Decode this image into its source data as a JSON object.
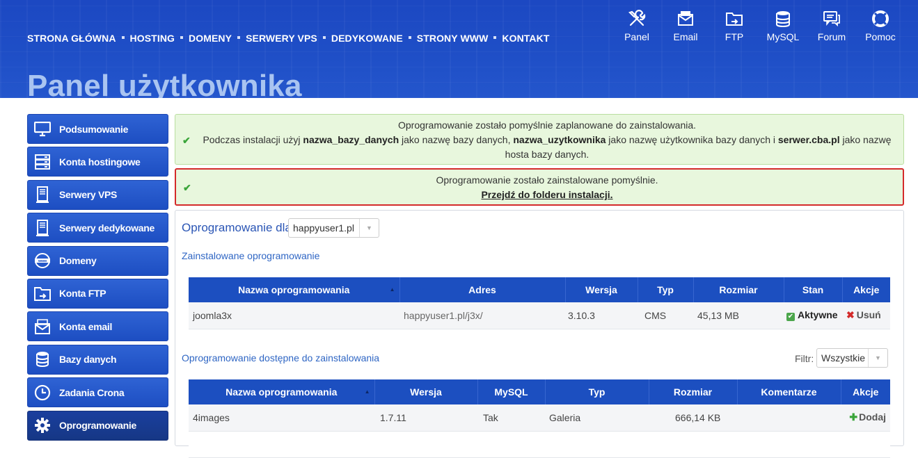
{
  "header": {
    "nav": [
      "STRONA GŁÓWNA",
      "HOSTING",
      "DOMENY",
      "SERWERY VPS",
      "DEDYKOWANE",
      "STRONY WWW",
      "KONTAKT"
    ],
    "quick_links": [
      {
        "label": "Panel",
        "icon": "tools-icon"
      },
      {
        "label": "Email",
        "icon": "email-icon"
      },
      {
        "label": "FTP",
        "icon": "ftp-folder-icon"
      },
      {
        "label": "MySQL",
        "icon": "database-icon"
      },
      {
        "label": "Forum",
        "icon": "forum-icon"
      },
      {
        "label": "Pomoc",
        "icon": "lifebuoy-icon"
      }
    ],
    "page_title": "Panel użytkownika"
  },
  "sidebar": {
    "items": [
      {
        "label": "Podsumowanie",
        "icon": "monitor-icon"
      },
      {
        "label": "Konta hostingowe",
        "icon": "server-stack-icon"
      },
      {
        "label": "Serwery VPS",
        "icon": "server-tower-icon"
      },
      {
        "label": "Serwery dedykowane",
        "icon": "server-tower-icon"
      },
      {
        "label": "Domeny",
        "icon": "www-globe-icon"
      },
      {
        "label": "Konta FTP",
        "icon": "ftp-folder-icon"
      },
      {
        "label": "Konta email",
        "icon": "email-icon"
      },
      {
        "label": "Bazy danych",
        "icon": "database-icon"
      },
      {
        "label": "Zadania Crona",
        "icon": "clock-icon"
      },
      {
        "label": "Oprogramowanie",
        "icon": "gear-icon"
      }
    ],
    "active": "Oprogramowanie"
  },
  "alerts": {
    "scheduled": {
      "line1": "Oprogramowanie zostało pomyślnie zaplanowane do zainstalowania.",
      "p1": "Podczas instalacji użyj ",
      "db_name": "nazwa_bazy_danych",
      "p2": " jako nazwę bazy danych, ",
      "db_user": "nazwa_uzytkownika",
      "p3": " jako nazwę użytkownika bazy danych i ",
      "db_host": "serwer.cba.pl",
      "p4": " jako nazwę hosta bazy danych."
    },
    "installed": {
      "line1": "Oprogramowanie zostało zainstalowane pomyślnie.",
      "link": "Przejdź do folderu instalacji."
    }
  },
  "software": {
    "for_label": "Oprogramowanie dla",
    "account": "happyuser1.pl",
    "installed_title": "Zainstalowane oprogramowanie",
    "installed_headers": [
      "Nazwa oprogramowania",
      "Adres",
      "Wersja",
      "Typ",
      "Rozmiar",
      "Stan",
      "Akcje"
    ],
    "installed_rows": [
      {
        "name": "joomla3x",
        "address": "happyuser1.pl/j3x/",
        "version": "3.10.3",
        "type": "CMS",
        "size": "45,13 MB",
        "status": "Aktywne",
        "action": "Usuń"
      }
    ],
    "available_title": "Oprogramowanie dostępne do zainstalowania",
    "filter_label": "Filtr:",
    "filter_value": "Wszystkie",
    "available_headers": [
      "Nazwa oprogramowania",
      "Wersja",
      "MySQL",
      "Typ",
      "Rozmiar",
      "Komentarze",
      "Akcje"
    ],
    "available_rows": [
      {
        "name": "4images",
        "version": "1.7.11",
        "mysql": "Tak",
        "type": "Galeria",
        "size": "666,14 KB",
        "comments": "",
        "action": "Dodaj"
      }
    ]
  }
}
